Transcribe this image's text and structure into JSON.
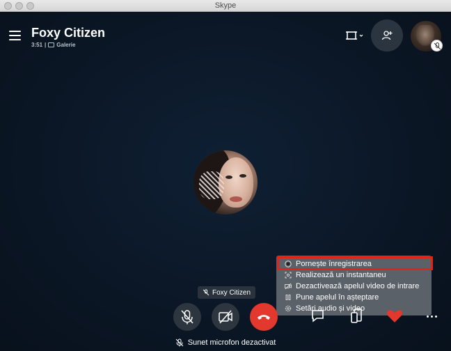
{
  "window": {
    "title": "Skype"
  },
  "call": {
    "contact_name": "Foxy Citizen",
    "duration": "3:51",
    "separator": "|",
    "view_mode": "Galerie"
  },
  "header": {
    "icons": [
      "menu-icon",
      "layout-icon",
      "add-participant-icon",
      "self-video-avatar",
      "mic-muted-icon"
    ]
  },
  "participant_label": {
    "name": "Foxy Citizen",
    "icon": "mic-muted-icon"
  },
  "more_menu": {
    "items": [
      {
        "label": "Pornește înregistrarea",
        "icon": "record-icon",
        "highlighted": true
      },
      {
        "label": "Realizează un instantaneu",
        "icon": "snapshot-icon"
      },
      {
        "label": "Dezactivează apelul video de intrare",
        "icon": "video-off-icon"
      },
      {
        "label": "Pune apelul în așteptare",
        "icon": "hold-icon"
      },
      {
        "label": "Setări audio și video",
        "icon": "gear-icon"
      }
    ]
  },
  "controls": {
    "buttons": [
      "mic-muted-icon",
      "camera-off-icon",
      "hang-up-icon",
      "chat-icon",
      "share-screen-icon",
      "heart-icon",
      "more-icon"
    ]
  },
  "status_bar": {
    "text": "Sunet microfon dezactivat"
  },
  "colors": {
    "highlight": "#e2231a",
    "hangup": "#e2382e",
    "background": "#0b1522",
    "menu": "#5a6168"
  }
}
